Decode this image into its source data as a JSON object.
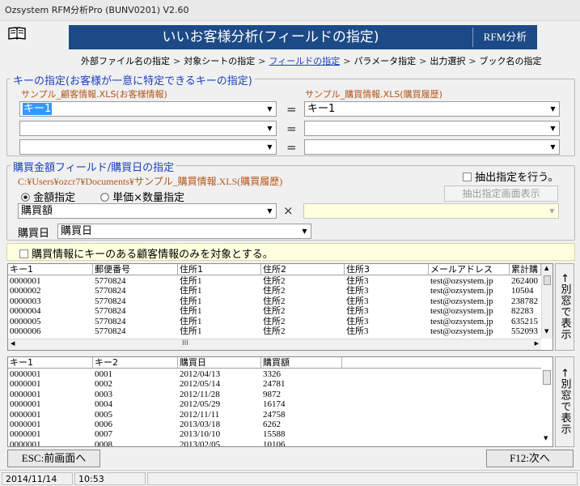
{
  "window": {
    "title": "Ozsystem RFM分析Pro (BUNV0201)   V2.60"
  },
  "banner": {
    "title": "いいお客様分析(フィールドの指定)",
    "side": "RFM分析"
  },
  "breadcrumb": [
    {
      "label": "外部ファイル名の指定",
      "active": false
    },
    {
      "label": "対象シートの指定",
      "active": false
    },
    {
      "label": "フィールドの指定",
      "active": true
    },
    {
      "label": "パラメータ指定",
      "active": false
    },
    {
      "label": "出力選択",
      "active": false
    },
    {
      "label": "ブック名の指定",
      "active": false
    }
  ],
  "breadcrumb_sep": ">",
  "key_section": {
    "legend": "キーの指定(お客様が一意に特定できるキーの指定)",
    "left_label": "サンプル_顧客情報.XLS(お客様情報)",
    "right_label": "サンプル_購買情報.XLS(購買履歴)",
    "equals": "=",
    "rows": [
      {
        "left": "キー1",
        "right": "キー1"
      },
      {
        "left": "",
        "right": ""
      },
      {
        "left": "",
        "right": ""
      }
    ]
  },
  "purchase_section": {
    "legend": "購買金額フィールド/購買日の指定",
    "path": "C:¥Users¥ozcr7¥Documents¥サンプル_購買情報.XLS(購買履歴)",
    "extract_label": "抽出指定を行う。",
    "extract_checked": false,
    "extract_button": "抽出指定画面表示",
    "radio_amount": "金額指定",
    "radio_unit": "単価×数量指定",
    "radio_selected": "amount",
    "amount_value": "購買額",
    "times": "×",
    "unit_value": "",
    "date_label": "購買日",
    "date_value": "購買日"
  },
  "filter": {
    "label": "購買情報にキーのある顧客情報のみを対象とする。",
    "checked": false
  },
  "grid1": {
    "columns": [
      "キー1",
      "郵便番号",
      "住所1",
      "住所2",
      "住所3",
      "メールアドレス",
      "累計購"
    ],
    "rows": [
      [
        "0000001",
        "5770824",
        "住所1",
        "住所2",
        "住所3",
        "test@ozsystem.jp",
        "262400"
      ],
      [
        "0000002",
        "5770824",
        "住所1",
        "住所2",
        "住所3",
        "test@ozsystem.jp",
        "10504"
      ],
      [
        "0000003",
        "5770824",
        "住所1",
        "住所2",
        "住所3",
        "test@ozsystem.jp",
        "238782"
      ],
      [
        "0000004",
        "5770824",
        "住所1",
        "住所2",
        "住所3",
        "test@ozsystem.jp",
        "82283"
      ],
      [
        "0000005",
        "5770824",
        "住所1",
        "住所2",
        "住所3",
        "test@ozsystem.jp",
        "635215"
      ],
      [
        "0000006",
        "5770824",
        "住所1",
        "住所2",
        "住所3",
        "test@ozsystem.jp",
        "552093"
      ]
    ],
    "hscroll_thumb": "III"
  },
  "grid2": {
    "columns": [
      "キー1",
      "キー2",
      "購買日",
      "購買額"
    ],
    "rows": [
      [
        "0000001",
        "0001",
        "2012/04/13",
        "3326"
      ],
      [
        "0000001",
        "0002",
        "2012/05/14",
        "24781"
      ],
      [
        "0000001",
        "0003",
        "2012/11/28",
        "9872"
      ],
      [
        "0000001",
        "0004",
        "2012/05/29",
        "16174"
      ],
      [
        "0000001",
        "0005",
        "2012/11/11",
        "24758"
      ],
      [
        "0000001",
        "0006",
        "2013/03/18",
        "6262"
      ],
      [
        "0000001",
        "0007",
        "2013/10/10",
        "15588"
      ],
      [
        "0000001",
        "0008",
        "2013/02/05",
        "10106"
      ]
    ]
  },
  "side_button": "←別窓で表示",
  "footer": {
    "back": "ESC:前画面へ",
    "next": "F12:次へ"
  },
  "status": {
    "date": "2014/11/14",
    "time": "10:53"
  },
  "colors": {
    "banner": "#1c4a86",
    "link": "#1a3fbf",
    "sublabel": "#b2541a",
    "selection": "#3399ff"
  }
}
